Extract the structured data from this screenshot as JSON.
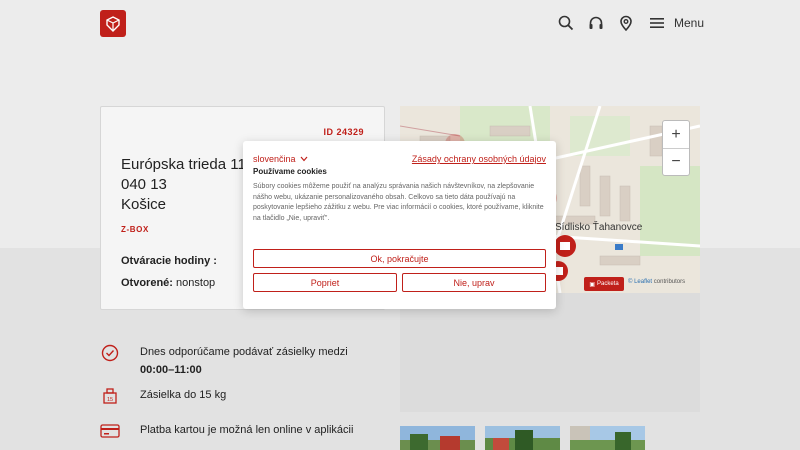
{
  "header": {
    "menu_label": "Menu",
    "icons": [
      "search-icon",
      "headset-icon",
      "location-pin-icon",
      "hamburger-icon"
    ]
  },
  "card": {
    "id": "ID 24329",
    "street": "Európska trieda 11",
    "zip": "040 13",
    "city": "Košice",
    "type": "Z-BOX",
    "hours_label": "Otváracie hodiny :",
    "open_label": "Otvorené:",
    "open_value": "nonstop"
  },
  "info": [
    {
      "icon": "clock-icon",
      "text_prefix": "Dnes odporúčame podávať zásielky medzi ",
      "text_bold": "00:00–11:00"
    },
    {
      "icon": "scale-icon",
      "text": "Zásielka do 15 kg"
    },
    {
      "icon": "card-icon",
      "text": "Platba kartou je možná len online v aplikácii"
    }
  ],
  "map": {
    "zoom_in": "+",
    "zoom_out": "−",
    "place_label": "Sídlisko Ťahanovce",
    "badge": "Packeta",
    "leaflet": "© Leaflet",
    "contributors": "contributors"
  },
  "cookie": {
    "language": "slovenčina",
    "policy_link": "Zásady ochrany osobných údajov",
    "title": "Používame cookies",
    "body": "Súbory cookies môžeme použiť na analýzu správania našich návštevníkov, na zlepšovanie nášho webu, ukázanie personalizovaného obsah. Celkovo sa tieto dáta používajú na poskytovanie lepšieho zážitku z webu. Pre viac informácií o cookies, ktoré používame, kliknite na tlačidlo „Nie, upraviť\".",
    "accept": "Ok, pokračujte",
    "reject": "Popriet",
    "customize": "Nie, uprav"
  },
  "colors": {
    "brand": "#c0201a"
  }
}
